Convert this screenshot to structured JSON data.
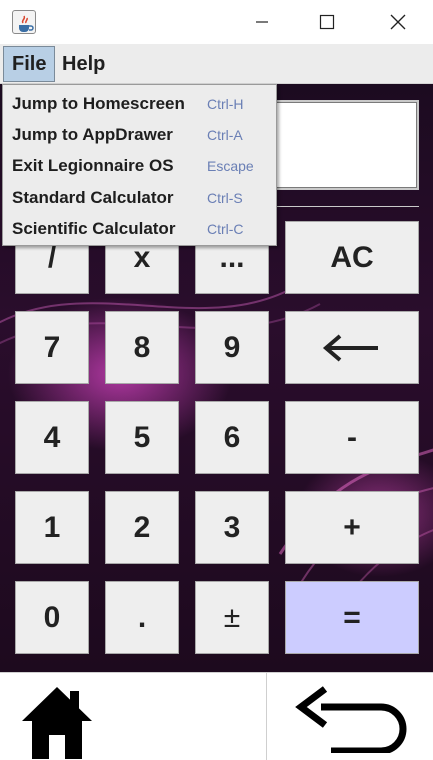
{
  "window": {
    "icons": [
      "java-app-icon",
      "minimize-icon",
      "maximize-icon",
      "close-icon"
    ]
  },
  "menubar": {
    "file_label": "File",
    "help_label": "Help"
  },
  "file_menu": {
    "items": [
      {
        "label": "Jump to Homescreen",
        "accelerator": "Ctrl-H"
      },
      {
        "label": "Jump to AppDrawer",
        "accelerator": "Ctrl-A"
      },
      {
        "label": "Exit Legionnaire OS",
        "accelerator": "Escape"
      },
      {
        "label": "Standard Calculator",
        "accelerator": "Ctrl-S"
      },
      {
        "label": "Scientific Calculator",
        "accelerator": "Ctrl-C"
      }
    ]
  },
  "display": {
    "value": ""
  },
  "keypad": {
    "divide": "/",
    "multiply": "x",
    "more": "...",
    "clear": "AC",
    "seven": "7",
    "eight": "8",
    "nine": "9",
    "four": "4",
    "five": "5",
    "six": "6",
    "minus": "-",
    "one": "1",
    "two": "2",
    "three": "3",
    "plus": "+",
    "zero": "0",
    "decimal": ".",
    "negate": "±",
    "equals": "=",
    "backspace_icon": "left-arrow-icon"
  },
  "bottom_nav": {
    "home_icon": "home-icon",
    "back_icon": "back-arrow-icon"
  },
  "colors": {
    "accent_equals": "#ccccff",
    "menu_highlight": "#b8cfe5",
    "accelerator": "#6a7fb5",
    "background": "#1c0b20"
  }
}
